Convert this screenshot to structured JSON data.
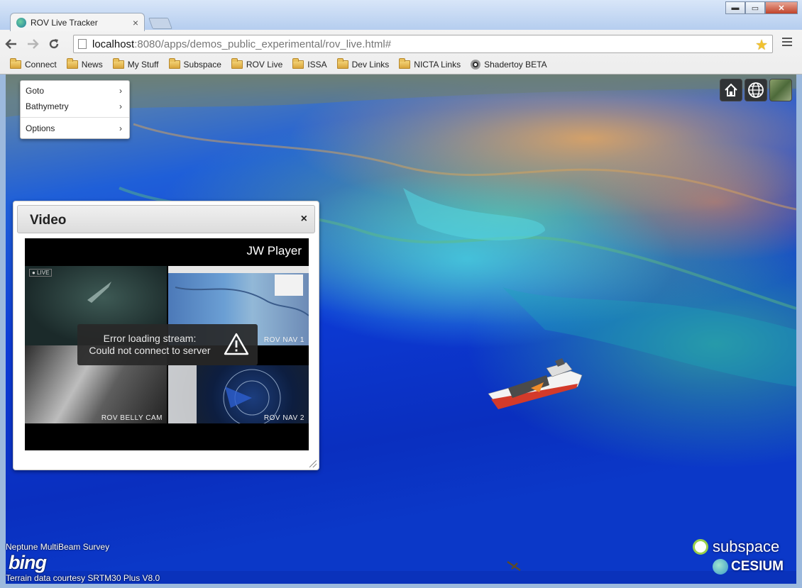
{
  "browser": {
    "tab_title": "ROV Live Tracker",
    "tab_close": "×",
    "url_host": "localhost",
    "url_path": ":8080/apps/demos_public_experimental/rov_live.html#",
    "window_controls": {
      "minimize": "▬",
      "maximize": "▭",
      "close": "✕"
    }
  },
  "bookmarks": [
    {
      "label": "Connect"
    },
    {
      "label": "News"
    },
    {
      "label": "My Stuff"
    },
    {
      "label": "Subspace"
    },
    {
      "label": "ROV Live"
    },
    {
      "label": "ISSA"
    },
    {
      "label": "Dev Links"
    },
    {
      "label": "NICTA Links"
    },
    {
      "label": "Shadertoy BETA"
    }
  ],
  "menu": {
    "items": [
      {
        "label": "Goto",
        "chevron": "›"
      },
      {
        "label": "Bathymetry",
        "chevron": "›"
      },
      {
        "label": "Options",
        "chevron": "›"
      }
    ]
  },
  "widgets": {
    "home_icon": "home-icon",
    "globe_icon": "globe-icon",
    "imagery_icon": "imagery-picker-icon"
  },
  "video_panel": {
    "title": "Video",
    "close": "×",
    "player_brand": "JW Player",
    "live_badge": "● LIVE",
    "cameras": [
      "ROV NAV 1",
      "ROV BELLY CAM",
      "ROV NAV 2"
    ],
    "error_line1": "Error loading stream:",
    "error_line2": "Could not connect to server"
  },
  "credits": {
    "survey": "Neptune MultiBeam Survey",
    "bing": "bing",
    "terrain": "Terrain data courtesy SRTM30 Plus V8.0"
  },
  "logos": {
    "subspace": "subspace",
    "cesium": "CESIUM"
  },
  "colors": {
    "terrain_deep": "#0d3bd6",
    "terrain_shallow": "#46d2e6",
    "terrain_high": "#f0aa5a"
  }
}
